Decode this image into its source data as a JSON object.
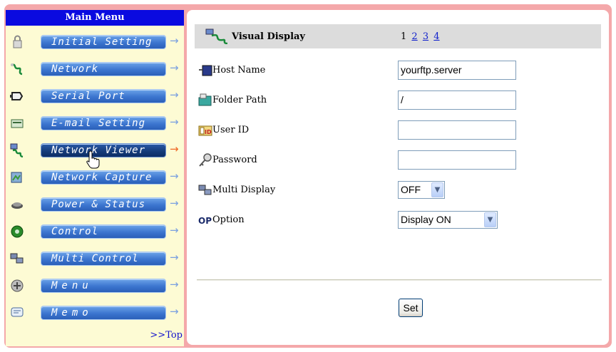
{
  "sidebar": {
    "title": "Main Menu",
    "items": [
      {
        "label": "Initial Setting",
        "icon": "lock-icon",
        "active": false
      },
      {
        "label": "Network",
        "icon": "network-icon",
        "active": false
      },
      {
        "label": "Serial Port",
        "icon": "serial-port-icon",
        "active": false
      },
      {
        "label": "E-mail Setting",
        "icon": "email-icon",
        "active": false
      },
      {
        "label": "Network Viewer",
        "icon": "network-viewer-icon",
        "active": true
      },
      {
        "label": "Network Capture",
        "icon": "network-capture-icon",
        "active": false
      },
      {
        "label": "Power & Status",
        "icon": "power-status-icon",
        "active": false
      },
      {
        "label": "Control",
        "icon": "control-icon",
        "active": false
      },
      {
        "label": "Multi Control",
        "icon": "multi-control-icon",
        "active": false
      },
      {
        "label": "Menu",
        "icon": "menu-icon",
        "active": false
      },
      {
        "label": "Memo",
        "icon": "memo-icon",
        "active": false
      }
    ],
    "top_link": ">>Top"
  },
  "main": {
    "section_title": "Visual Display",
    "pages": {
      "current": "1",
      "links": [
        "2",
        "3",
        "4"
      ]
    },
    "fields": {
      "host_name": {
        "label": "Host Name",
        "value": "yourftp.server"
      },
      "folder_path": {
        "label": "Folder Path",
        "value": "/"
      },
      "user_id": {
        "label": "User ID",
        "value": ""
      },
      "password": {
        "label": "Password",
        "value": ""
      },
      "multi_display": {
        "label": "Multi Display",
        "value": "OFF"
      },
      "option": {
        "label": "Option",
        "value": "Display ON"
      }
    },
    "set_label": "Set"
  },
  "colors": {
    "frame": "#f4a8aa",
    "sidebar_bg": "#fdfbd4",
    "header_bg": "#0a0ae0",
    "button_blue": "#3c75cf",
    "active_arrow": "#ee6622"
  }
}
